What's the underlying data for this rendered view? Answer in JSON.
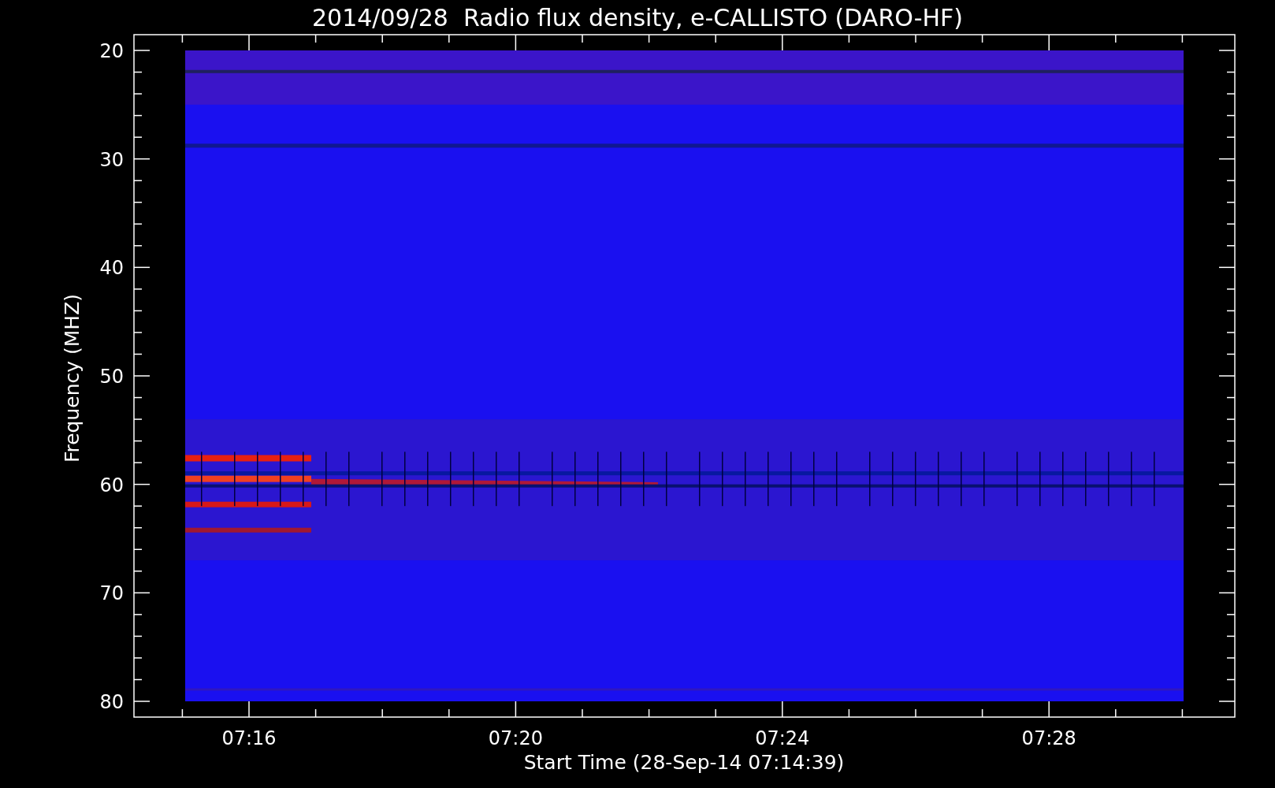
{
  "title": "2014/09/28  Radio flux density, e-CALLISTO (DARO-HF)",
  "y_axis": {
    "label": "Frequency (MHZ)",
    "ticks": [
      "20",
      "30",
      "40",
      "50",
      "60",
      "70",
      "80"
    ]
  },
  "x_axis": {
    "label": "Start Time (28-Sep-14 07:14:39)",
    "ticks": [
      "07:16",
      "07:20",
      "07:24",
      "07:28"
    ]
  }
}
